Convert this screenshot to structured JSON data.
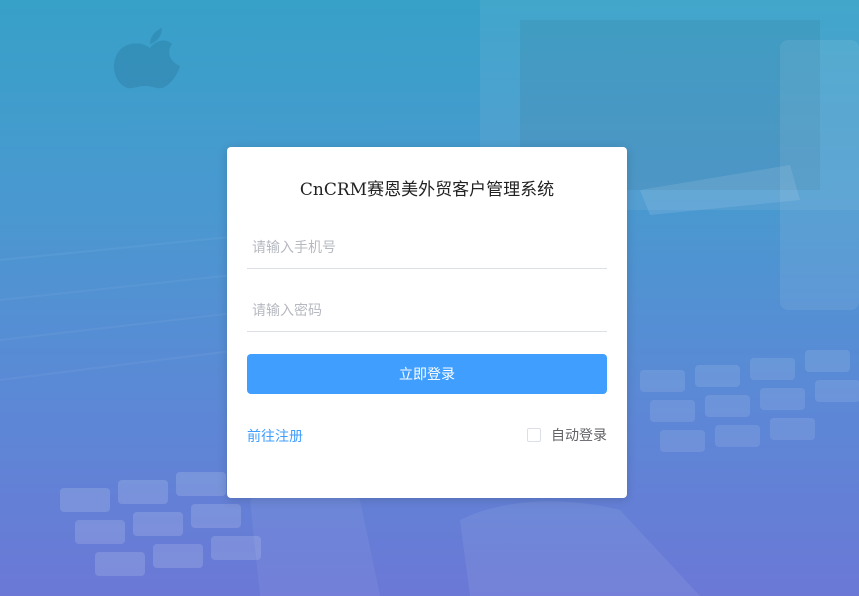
{
  "app": {
    "title": "CnCRM赛恩美外贸客户管理系统"
  },
  "form": {
    "phone_placeholder": "请输入手机号",
    "phone_value": "",
    "password_placeholder": "请输入密码",
    "password_value": "",
    "login_label": "立即登录",
    "register_label": "前往注册",
    "auto_login_label": "自动登录",
    "auto_login_checked": false
  },
  "colors": {
    "accent": "#409eff",
    "background_top": "#37a1c8",
    "background_bottom": "#6b78d6"
  },
  "icons": {
    "background_logo": "apple-logo"
  }
}
